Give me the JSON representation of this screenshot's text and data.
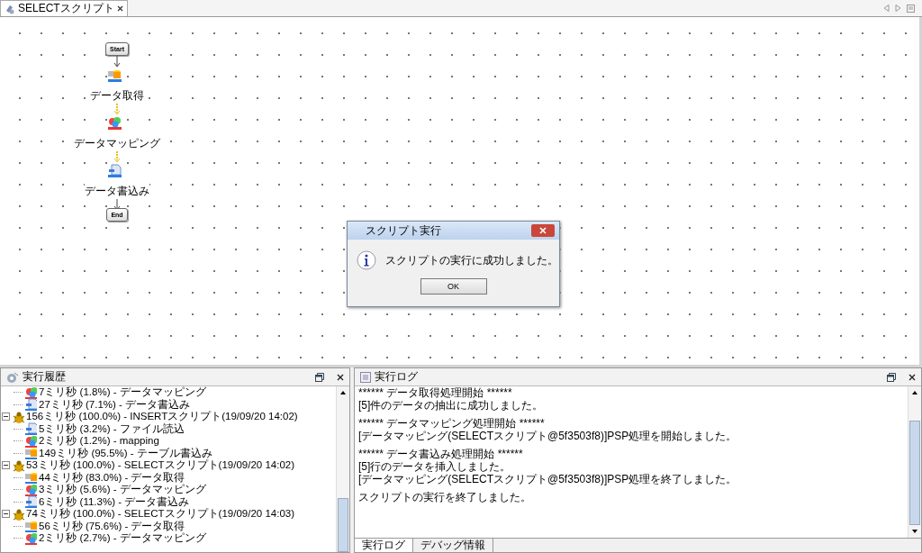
{
  "editor": {
    "tabs": [
      {
        "label": "SELECTスクリプト",
        "selected": true
      }
    ]
  },
  "flow": {
    "nodes": [
      {
        "kind": "start",
        "label": "Start"
      },
      {
        "kind": "fetch",
        "label": "データ取得"
      },
      {
        "kind": "mapping",
        "label": "データマッピング"
      },
      {
        "kind": "write",
        "label": "データ書込み"
      },
      {
        "kind": "end",
        "label": "End"
      }
    ]
  },
  "dialog": {
    "title": "スクリプト実行",
    "message": "スクリプトの実行に成功しました。",
    "button": "OK"
  },
  "history": {
    "title": "実行履歴",
    "items": [
      {
        "kind": "mapping",
        "label": "7ミリ秒 (1.8%) - データマッピング"
      },
      {
        "kind": "write",
        "label": "27ミリ秒 (7.1%) - データ書込み"
      },
      {
        "kind": "script",
        "label": "156ミリ秒 (100.0%) - INSERTスクリプト(19/09/20 14:02)",
        "expanded": true,
        "children": [
          {
            "kind": "write",
            "label": "5ミリ秒 (3.2%) - ファイル読込"
          },
          {
            "kind": "mapping",
            "label": "2ミリ秒 (1.2%) - mapping"
          },
          {
            "kind": "fetch",
            "label": "149ミリ秒 (95.5%) - テーブル書込み"
          }
        ]
      },
      {
        "kind": "script",
        "label": "53ミリ秒 (100.0%) - SELECTスクリプト(19/09/20 14:02)",
        "expanded": true,
        "children": [
          {
            "kind": "fetch",
            "label": "44ミリ秒 (83.0%) - データ取得"
          },
          {
            "kind": "mapping",
            "label": "3ミリ秒 (5.6%) - データマッピング"
          },
          {
            "kind": "write",
            "label": "6ミリ秒 (11.3%) - データ書込み"
          }
        ]
      },
      {
        "kind": "script",
        "label": "74ミリ秒 (100.0%) - SELECTスクリプト(19/09/20 14:03)",
        "expanded": true,
        "children": [
          {
            "kind": "fetch",
            "label": "56ミリ秒 (75.6%) - データ取得"
          },
          {
            "kind": "mapping",
            "label": "2ミリ秒 (2.7%) - データマッピング"
          }
        ]
      }
    ]
  },
  "log": {
    "title": "実行ログ",
    "paragraphs": [
      [
        "****** データ取得処理開始 ******",
        "[5]件のデータの抽出に成功しました。"
      ],
      [
        "****** データマッピング処理開始 ******",
        "[データマッピング(SELECTスクリプト@5f3503f8)]PSP処理を開始しました。"
      ],
      [
        "****** データ書込み処理開始 ******",
        "[5]行のデータを挿入しました。",
        "[データマッピング(SELECTスクリプト@5f3503f8)]PSP処理を終了しました。"
      ],
      [
        "スクリプトの実行を終了しました。"
      ]
    ],
    "tabs": [
      {
        "label": "実行ログ",
        "selected": true
      },
      {
        "label": "デバッグ情報",
        "selected": false
      }
    ]
  }
}
